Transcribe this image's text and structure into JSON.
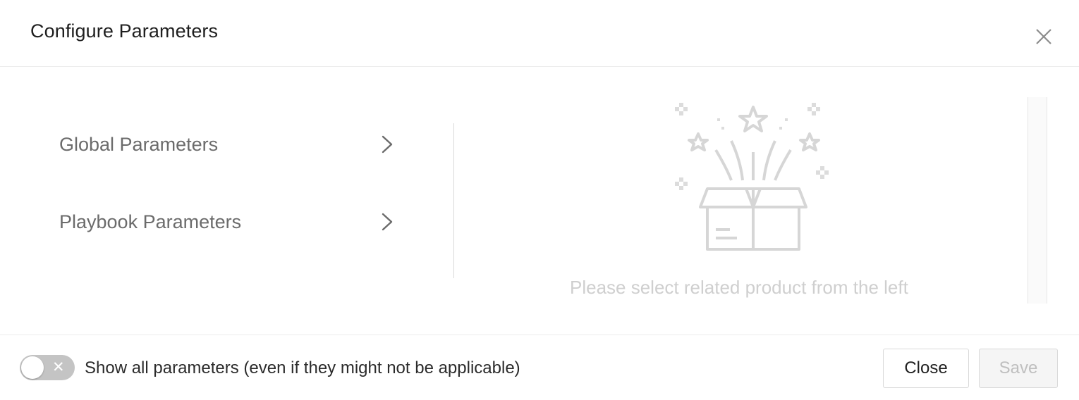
{
  "dialog": {
    "title": "Configure Parameters",
    "close_icon": "close-icon"
  },
  "nav": {
    "items": [
      {
        "label": "Global Parameters",
        "icon": "chevron-right-icon"
      },
      {
        "label": "Playbook Parameters",
        "icon": "chevron-right-icon"
      }
    ]
  },
  "empty_state": {
    "icon": "open-box-icon",
    "message": "Please select related product from the left"
  },
  "footer": {
    "toggle": {
      "state": "off",
      "off_symbol": "✕",
      "label": "Show all parameters (even if they might not be applicable)"
    },
    "close_label": "Close",
    "save_label": "Save"
  },
  "colors": {
    "title": "#1f1f1f",
    "nav_text": "#6b6b6b",
    "empty_text": "#cfcfcf",
    "toggle_off": "#c4c4c4",
    "save_disabled_text": "#bfbfbf"
  }
}
